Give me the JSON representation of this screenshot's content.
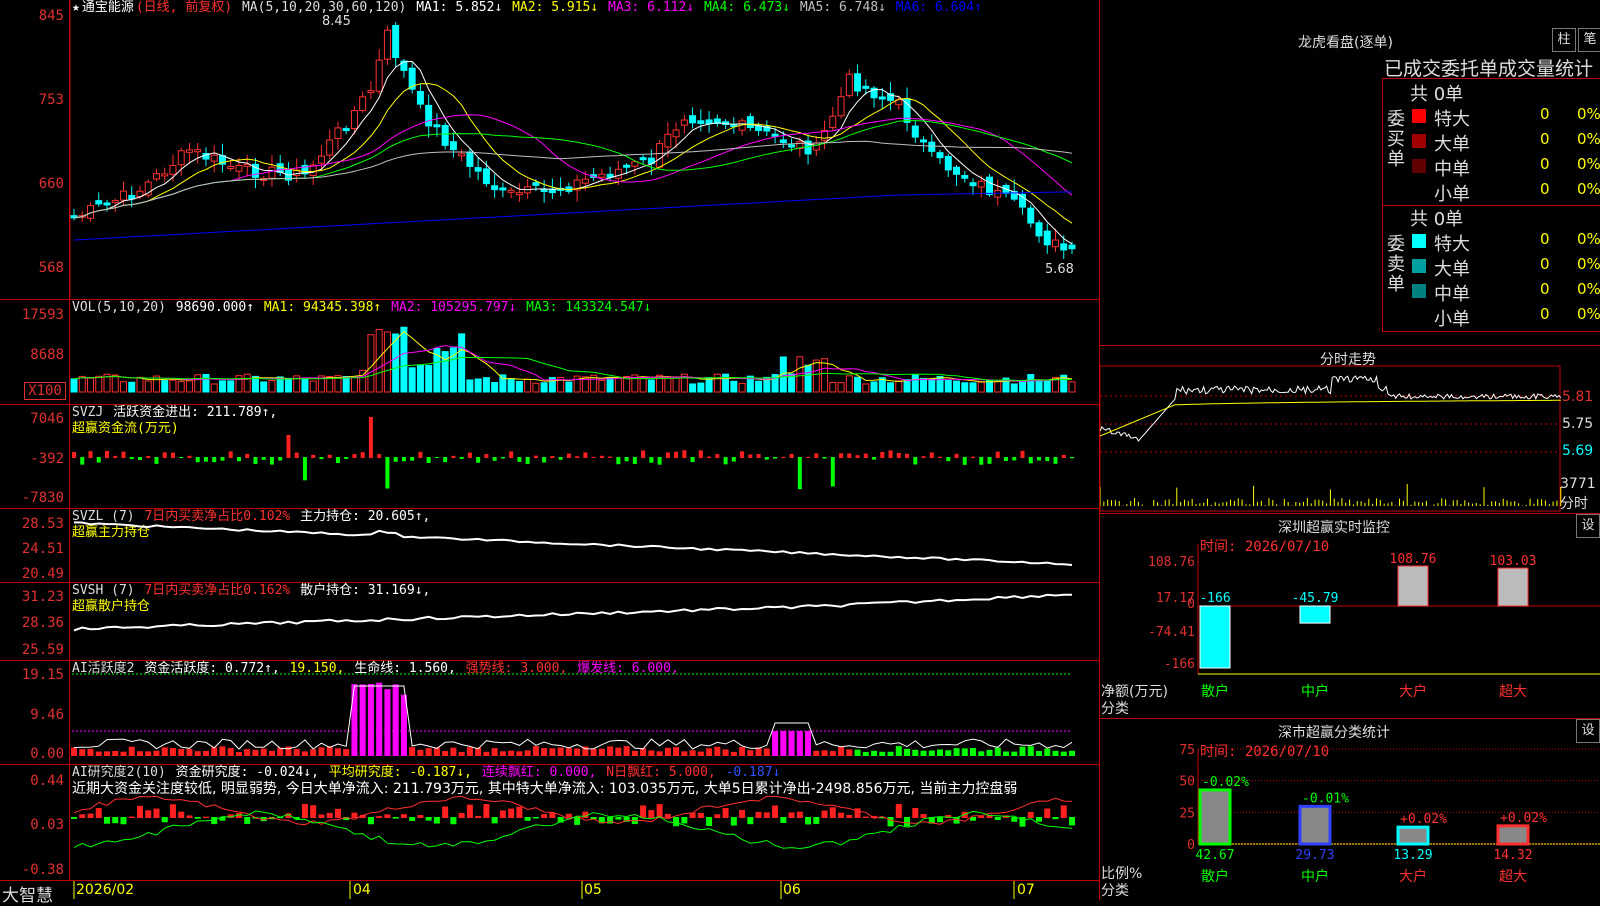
{
  "stock": {
    "name": "通宝能源",
    "mode": "(日线, 前复权)"
  },
  "kline": {
    "ma_label": "MA(5,10,20,30,60,120)",
    "ma": [
      {
        "label": "MA1:",
        "value": "5.852↓",
        "color": "#ffffff"
      },
      {
        "label": "MA2:",
        "value": "5.915↓",
        "color": "#ffff00"
      },
      {
        "label": "MA3:",
        "value": "6.112↓",
        "color": "#ff00ff"
      },
      {
        "label": "MA4:",
        "value": "6.473↓",
        "color": "#00ff00"
      },
      {
        "label": "MA5:",
        "value": "6.748↓",
        "color": "#c0c0c0"
      },
      {
        "label": "MA6:",
        "value": "6.604↑",
        "color": "#0000ff"
      }
    ],
    "yticks": [
      "845",
      "753",
      "660",
      "568"
    ],
    "high_label": "8.45",
    "low_label": "5.68"
  },
  "vol": {
    "label": "VOL(5,10,20)",
    "value": "98690.000↑",
    "ma1": "MA1: 94345.398↑",
    "ma2": "MA2: 105295.797↓",
    "ma3": "MA3: 143324.547↓",
    "yticks": [
      "17593",
      "8688"
    ],
    "unit": "X100"
  },
  "svzj": {
    "label": "SVZJ",
    "title": "活跃资金进出: 211.789↑,",
    "sub": "超赢资金流(万元)",
    "yticks": [
      "7046",
      "-392",
      "-7830"
    ]
  },
  "svzl": {
    "label": "SVZL (7)",
    "a": "7日内买卖净占比0.102%",
    "b": "主力持仓: 20.605↑,",
    "sub": "超赢主力持仓",
    "yticks": [
      "28.53",
      "24.51",
      "20.49"
    ]
  },
  "svsh": {
    "label": "SVSH (7)",
    "a": "7日内买卖净占比0.162%",
    "b": "散户持仓: 31.169↓,",
    "sub": "超赢散户持仓",
    "yticks": [
      "31.23",
      "28.36",
      "25.59"
    ]
  },
  "ai1": {
    "label": "AI活跃度2",
    "a": "资金活跃度: 0.772↑,",
    "b": "19.150,",
    "c": "生命线: 1.560,",
    "d": "强势线: 3.000,",
    "e": "爆发线: 6.000,",
    "yticks": [
      "19.15",
      "9.46",
      "0.00"
    ]
  },
  "ai2": {
    "label": "AI研究度2(10)",
    "a": "资金研究度: -0.024↓,",
    "b": "平均研究度: -0.187↓,",
    "c": "连续飘红: 0.000,",
    "d": "N日飘红: 5.000,",
    "e": "-0.187↓",
    "note": "近期大资金关注度较低, 明显弱势, 今日大单净流入: 211.793万元, 其中特大单净流入: 103.035万元, 大单5日累计净出-2498.856万元, 当前主力控盘弱",
    "yticks": [
      "0.44",
      "0.03",
      "-0.38"
    ]
  },
  "xaxis": {
    "brand": "大智慧",
    "labels": [
      "2026/02",
      "04",
      "05",
      "06",
      "07"
    ]
  },
  "right": {
    "lhb_title": "龙虎看盘(逐单)",
    "btn_bar": "柱",
    "btn_pen": "笔",
    "tabs": "已成交委托单成交量统计",
    "buy": {
      "title": "委买单",
      "total": "共 0单",
      "rows": [
        {
          "n": "特大",
          "v": "0",
          "p": "0%",
          "c": "#ff0000"
        },
        {
          "n": "大单",
          "v": "0",
          "p": "0%",
          "c": "#a00000"
        },
        {
          "n": "中单",
          "v": "0",
          "p": "0%",
          "c": "#600000"
        },
        {
          "n": "小单",
          "v": "0",
          "p": "0%",
          "c": "#000000"
        }
      ]
    },
    "sell": {
      "title": "委卖单",
      "total": "共 0单",
      "rows": [
        {
          "n": "特大",
          "v": "0",
          "p": "0%",
          "c": "#00ffff"
        },
        {
          "n": "大单",
          "v": "0",
          "p": "0%",
          "c": "#00a0a0"
        },
        {
          "n": "中单",
          "v": "0",
          "p": "0%",
          "c": "#008080"
        },
        {
          "n": "小单",
          "v": "0",
          "p": "0%",
          "c": "#000000"
        }
      ]
    },
    "fs_title": "分时走势",
    "fs_y": [
      "5.81",
      "5.75",
      "5.69"
    ],
    "fs_vol": "3771",
    "fs_sub": "分时",
    "mon_title": "深圳超赢实时监控",
    "mon_time": "时间: 2026/07/10",
    "btn_set": "设",
    "mon_y": [
      "108.76",
      "17.17",
      "0",
      "-74.41",
      "-166"
    ],
    "mon_vals": [
      "-166",
      "-45.79",
      "108.76",
      "103.03"
    ],
    "mon_axis": "净额(万元)",
    "mon_axis2": "分类",
    "cats": [
      "散户",
      "中户",
      "大户",
      "超大"
    ],
    "cls_title": "深市超赢分类统计",
    "cls_time": "时间: 2026/07/10",
    "cls_y": [
      "75",
      "50",
      "25",
      "0"
    ],
    "cls_pct": [
      "-0.02%",
      "-0.01%",
      "+0.02%",
      "+0.02%"
    ],
    "cls_vals": [
      "42.67",
      "29.73",
      "13.29",
      "14.32"
    ],
    "cls_axis": "比例%",
    "cls_axis2": "分类"
  }
}
